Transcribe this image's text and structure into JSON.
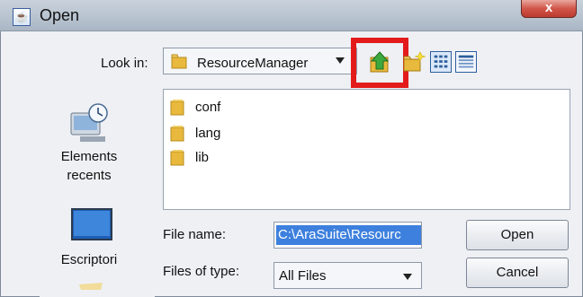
{
  "window": {
    "title": "Open",
    "close_glyph": "x"
  },
  "look_in": {
    "label": "Look in:",
    "value": "ResourceManager"
  },
  "toolbar": {
    "up_icon": "up-one-level-icon",
    "new_folder_icon": "new-folder-icon",
    "list_view_icon": "list-view-icon",
    "details_view_icon": "details-view-icon",
    "highlight_color": "#e31b1b"
  },
  "places": [
    {
      "label": "Elements recents",
      "icon": "recent-items-icon"
    },
    {
      "label": "Escriptori",
      "icon": "desktop-icon"
    }
  ],
  "files": [
    {
      "name": "conf",
      "icon": "folder-icon"
    },
    {
      "name": "lang",
      "icon": "folder-icon"
    },
    {
      "name": "lib",
      "icon": "folder-icon"
    }
  ],
  "file_name": {
    "label": "File name:",
    "value": "C:\\AraSuite\\Resourc"
  },
  "file_type": {
    "label": "Files of type:",
    "value": "All Files"
  },
  "buttons": {
    "open": "Open",
    "cancel": "Cancel"
  },
  "colors": {
    "selection": "#3d80de",
    "close_button": "#c8463b",
    "folder": "#e8b93c"
  }
}
